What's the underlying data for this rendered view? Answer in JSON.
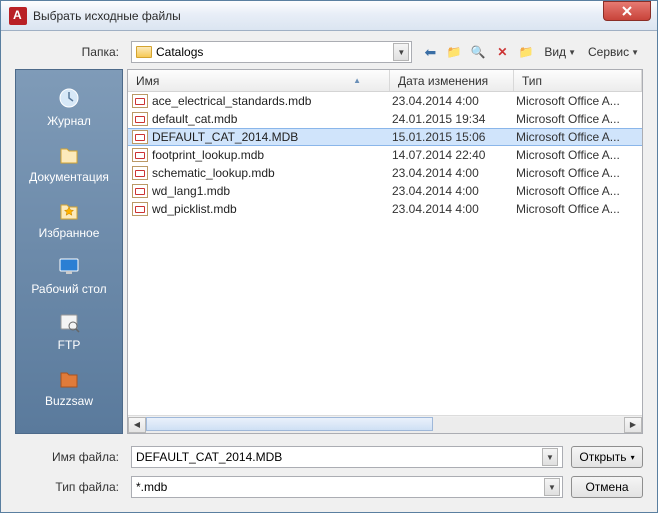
{
  "window": {
    "title": "Выбрать исходные файлы"
  },
  "top": {
    "folder_label": "Папка:",
    "folder_value": "Catalogs",
    "view_label": "Вид",
    "service_label": "Сервис"
  },
  "sidebar": {
    "items": [
      {
        "label": "Журнал"
      },
      {
        "label": "Документация"
      },
      {
        "label": "Избранное"
      },
      {
        "label": "Рабочий стол"
      },
      {
        "label": "FTP"
      },
      {
        "label": "Buzzsaw"
      }
    ]
  },
  "columns": {
    "name": "Имя",
    "date": "Дата изменения",
    "type": "Тип"
  },
  "files": [
    {
      "name": "ace_electrical_standards.mdb",
      "date": "23.04.2014 4:00",
      "type": "Microsoft Office A...",
      "selected": false
    },
    {
      "name": "default_cat.mdb",
      "date": "24.01.2015 19:34",
      "type": "Microsoft Office A...",
      "selected": false
    },
    {
      "name": "DEFAULT_CAT_2014.MDB",
      "date": "15.01.2015 15:06",
      "type": "Microsoft Office A...",
      "selected": true
    },
    {
      "name": "footprint_lookup.mdb",
      "date": "14.07.2014 22:40",
      "type": "Microsoft Office A...",
      "selected": false
    },
    {
      "name": "schematic_lookup.mdb",
      "date": "23.04.2014 4:00",
      "type": "Microsoft Office A...",
      "selected": false
    },
    {
      "name": "wd_lang1.mdb",
      "date": "23.04.2014 4:00",
      "type": "Microsoft Office A...",
      "selected": false
    },
    {
      "name": "wd_picklist.mdb",
      "date": "23.04.2014 4:00",
      "type": "Microsoft Office A...",
      "selected": false
    }
  ],
  "bottom": {
    "filename_label": "Имя файла:",
    "filename_value": "DEFAULT_CAT_2014.MDB",
    "filetype_label": "Тип файла:",
    "filetype_value": "*.mdb",
    "open_label": "Открыть",
    "cancel_label": "Отмена"
  },
  "icons": {
    "back": "⇐",
    "up": "📁",
    "search": "🔍",
    "delete": "✖",
    "new": "📁"
  }
}
